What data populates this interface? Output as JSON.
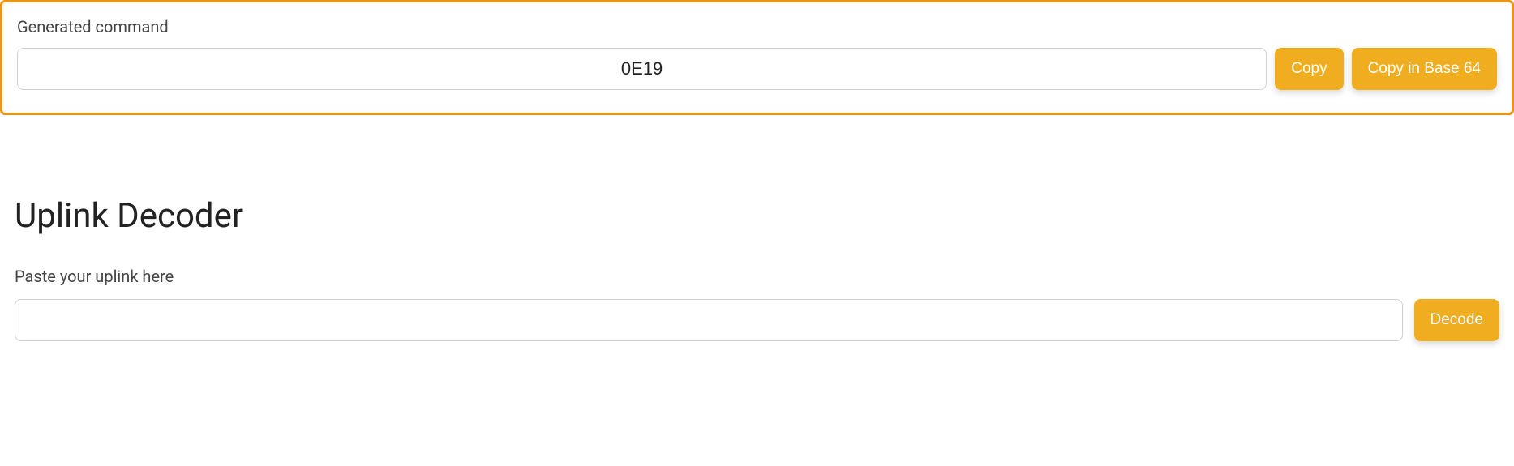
{
  "generated_command": {
    "label": "Generated command",
    "value": "0E19",
    "copy_label": "Copy",
    "copy_base64_label": "Copy in Base 64"
  },
  "uplink_decoder": {
    "title": "Uplink Decoder",
    "label": "Paste your uplink here",
    "value": "",
    "decode_label": "Decode"
  }
}
